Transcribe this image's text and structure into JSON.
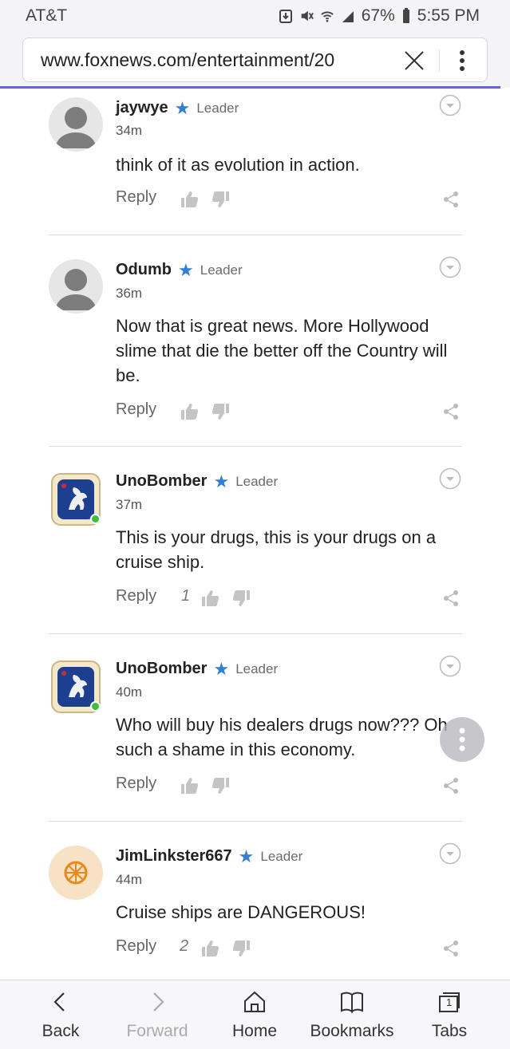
{
  "status_bar": {
    "carrier": "AT&T",
    "battery": "67%",
    "time": "5:55 PM"
  },
  "browser": {
    "url": "www.foxnews.com/entertainment/20"
  },
  "comments": [
    {
      "username": "jaywye",
      "badge": "Leader",
      "time": "34m",
      "text": "think of it as evolution in action.",
      "reply_label": "Reply",
      "upvotes": "",
      "avatar": "default-avatar"
    },
    {
      "username": "Odumb",
      "badge": "Leader",
      "time": "36m",
      "text": "Now that is great news.  More Hollywood slime that die the better off the Country will be.",
      "reply_label": "Reply",
      "upvotes": "",
      "avatar": "default-avatar"
    },
    {
      "username": "UnoBomber",
      "badge": "Leader",
      "time": "37m",
      "text": "This is your drugs, this is your drugs on a cruise ship.",
      "reply_label": "Reply",
      "upvotes": "1",
      "avatar": "lion-emblem-avatar",
      "online": true
    },
    {
      "username": "UnoBomber",
      "badge": "Leader",
      "time": "40m",
      "text": "Who will buy his dealers drugs now??? Oh such a shame in this economy.",
      "reply_label": "Reply",
      "upvotes": "",
      "avatar": "lion-emblem-avatar",
      "online": true
    },
    {
      "username": "JimLinkster667",
      "badge": "Leader",
      "time": "44m",
      "text": "Cruise ships are DANGEROUS!",
      "reply_label": "Reply",
      "upvotes": "2",
      "avatar": "wheel-avatar"
    }
  ],
  "bottom_nav": {
    "back": "Back",
    "forward": "Forward",
    "home": "Home",
    "bookmarks": "Bookmarks",
    "tabs": "Tabs",
    "tab_count": "1"
  },
  "colors": {
    "accent_star": "#2d7fd8",
    "progress": "#6b63d8",
    "online": "#3cc03c"
  }
}
